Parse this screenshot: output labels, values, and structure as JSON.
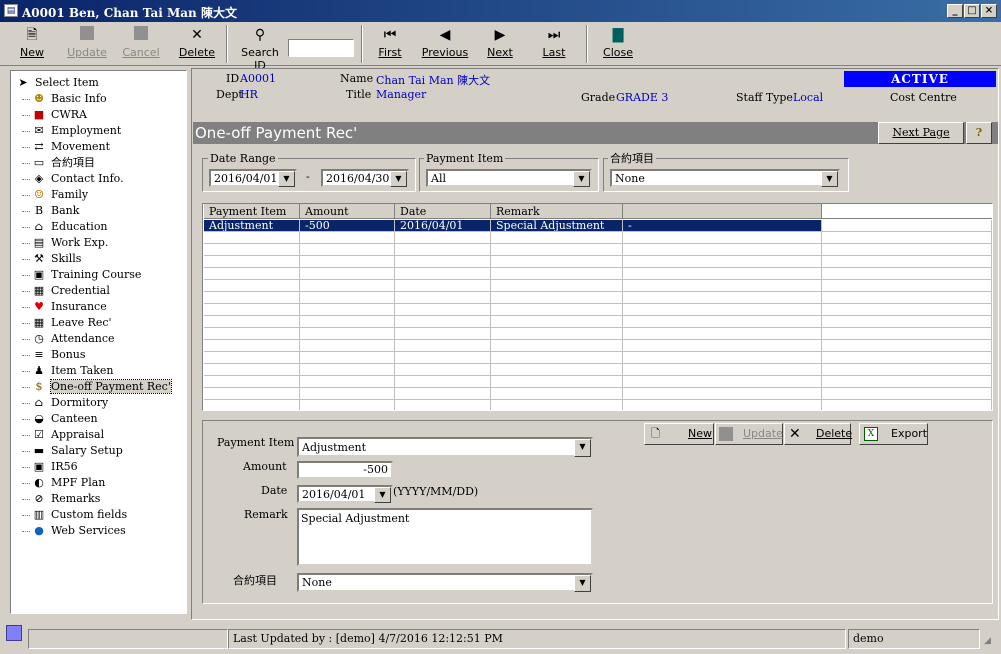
{
  "window": {
    "title": "A0001 Ben, Chan Tai Man 陳大文"
  },
  "toolbar": {
    "new": "New",
    "update": "Update",
    "cancel": "Cancel",
    "delete": "Delete",
    "search_label": "Search ID",
    "search_value": "",
    "first": "First",
    "previous": "Previous",
    "next": "Next",
    "last": "Last",
    "close": "Close"
  },
  "sidebar": {
    "items": [
      {
        "label": "Select Item",
        "icon": "pointer-icon"
      },
      {
        "label": "Basic Info",
        "icon": "person-icon"
      },
      {
        "label": "CWRA",
        "icon": "cwra-icon"
      },
      {
        "label": "Employment",
        "icon": "envelope-icon"
      },
      {
        "label": "Movement",
        "icon": "movement-icon"
      },
      {
        "label": "合約項目",
        "icon": "folder-icon"
      },
      {
        "label": "Contact Info.",
        "icon": "contact-icon"
      },
      {
        "label": "Family",
        "icon": "family-icon"
      },
      {
        "label": "Bank",
        "icon": "bank-icon"
      },
      {
        "label": "Education",
        "icon": "education-icon"
      },
      {
        "label": "Work Exp.",
        "icon": "document-icon"
      },
      {
        "label": "Skills",
        "icon": "wrench-icon"
      },
      {
        "label": "Training Course",
        "icon": "training-icon"
      },
      {
        "label": "Credential",
        "icon": "credential-icon"
      },
      {
        "label": "Insurance",
        "icon": "heart-icon"
      },
      {
        "label": "Leave Rec'",
        "icon": "calendar-icon"
      },
      {
        "label": "Attendance",
        "icon": "clock-icon"
      },
      {
        "label": "Bonus",
        "icon": "bonus-icon"
      },
      {
        "label": "Item Taken",
        "icon": "item-icon"
      },
      {
        "label": "One-off Payment Rec'",
        "icon": "dollar-icon"
      },
      {
        "label": "Dormitory",
        "icon": "house-icon"
      },
      {
        "label": "Canteen",
        "icon": "canteen-icon"
      },
      {
        "label": "Appraisal",
        "icon": "checkbox-icon"
      },
      {
        "label": "Salary Setup",
        "icon": "salary-icon"
      },
      {
        "label": "IR56",
        "icon": "floppy-icon"
      },
      {
        "label": "MPF Plan",
        "icon": "mpf-icon"
      },
      {
        "label": "Remarks",
        "icon": "paperclip-icon"
      },
      {
        "label": "Custom fields",
        "icon": "custom-icon"
      },
      {
        "label": "Web Services",
        "icon": "globe-icon"
      }
    ]
  },
  "header": {
    "id_label": "ID",
    "id_value": "A0001",
    "dept_label": "Dept",
    "dept_value": "HR",
    "name_label": "Name",
    "name_value": "Chan Tai Man  陳大文",
    "title_label": "Title",
    "title_value": "Manager",
    "grade_label": "Grade",
    "grade_value": "GRADE 3",
    "staff_type_label": "Staff Type",
    "staff_type_value": "Local",
    "status": "ACTIVE",
    "cost_centre_label": "Cost Centre"
  },
  "section": {
    "title": "One-off Payment Rec'",
    "next_page": "Next Page"
  },
  "filters": {
    "date_range_label": "Date Range",
    "date_from": "2016/04/01",
    "dash": "-",
    "date_to": "2016/04/30",
    "payment_item_label": "Payment Item",
    "payment_item_value": "All",
    "contract_label": "合約項目",
    "contract_value": "None"
  },
  "grid": {
    "columns": [
      "Payment Item",
      "Amount",
      "Date",
      "Remark",
      ""
    ],
    "rows": [
      [
        "Adjustment",
        "-500",
        "2016/04/01",
        "Special Adjustment",
        "-"
      ]
    ]
  },
  "detail_actions": {
    "new": "New",
    "update": "Update",
    "delete": "Delete",
    "export": "Export"
  },
  "form": {
    "payment_item_label": "Payment Item",
    "payment_item_value": "Adjustment",
    "amount_label": "Amount",
    "amount_value": "-500",
    "date_label": "Date",
    "date_value": "2016/04/01",
    "date_hint": "(YYYY/MM/DD)",
    "remark_label": "Remark",
    "remark_value": "Special Adjustment",
    "contract_label": "合約項目",
    "contract_value": "None"
  },
  "status": {
    "last_updated": "Last Updated by : [demo]  4/7/2016 12:12:51 PM",
    "user": "demo"
  },
  "colors": {
    "title_start": "#0a246a",
    "title_end": "#3a6ea5",
    "selection": "#0a246a",
    "status_bg": "#0000ff",
    "status_fg": "#ffffff",
    "section_bar": "#808080",
    "field_text": "#0000c0"
  }
}
